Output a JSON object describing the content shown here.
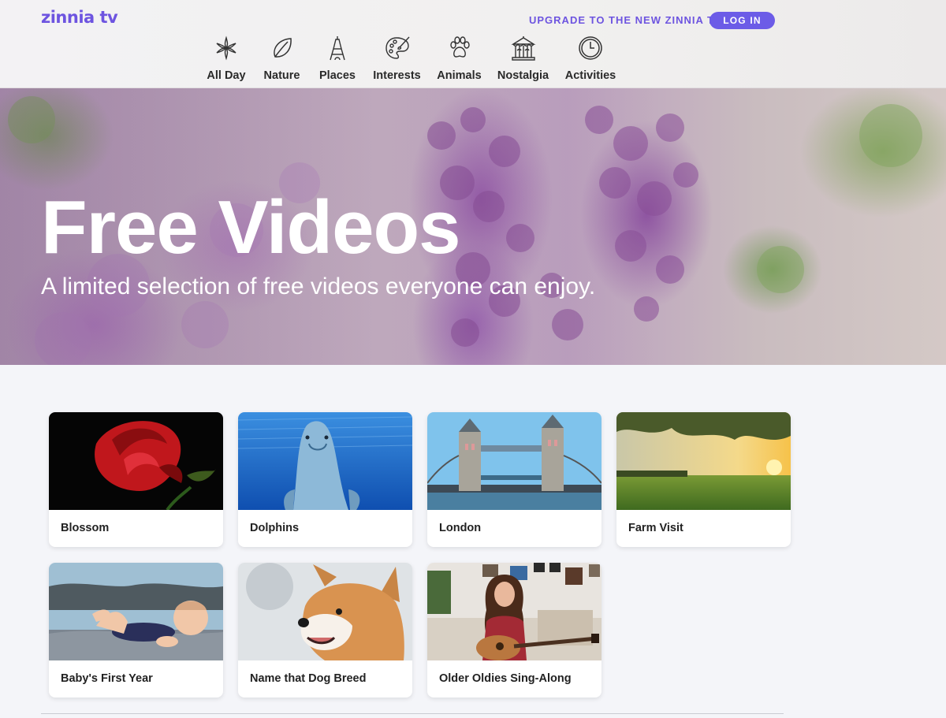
{
  "header": {
    "logo": "zinnia tv",
    "upgrade_link": "UPGRADE TO THE NEW ZINNIA TV",
    "login_label": "LOG IN"
  },
  "nav": {
    "items": [
      {
        "label": "All Day",
        "icon": "asterisk-flower-icon"
      },
      {
        "label": "Nature",
        "icon": "leaf-icon"
      },
      {
        "label": "Places",
        "icon": "eiffel-tower-icon"
      },
      {
        "label": "Interests",
        "icon": "paint-palette-icon"
      },
      {
        "label": "Animals",
        "icon": "paw-print-icon"
      },
      {
        "label": "Nostalgia",
        "icon": "carousel-icon"
      },
      {
        "label": "Activities",
        "icon": "clock-icon"
      }
    ]
  },
  "hero": {
    "title": "Free Videos",
    "subtitle": "A limited selection of free videos everyone can enjoy."
  },
  "videos": [
    {
      "title": "Blossom"
    },
    {
      "title": "Dolphins"
    },
    {
      "title": "London"
    },
    {
      "title": "Farm Visit"
    },
    {
      "title": "Baby's First Year"
    },
    {
      "title": "Name that Dog Breed"
    },
    {
      "title": "Older Oldies Sing-Along"
    }
  ],
  "colors": {
    "brand": "#6d54e0",
    "button": "#6c5ce7",
    "page_background": "#f4f5f9"
  }
}
